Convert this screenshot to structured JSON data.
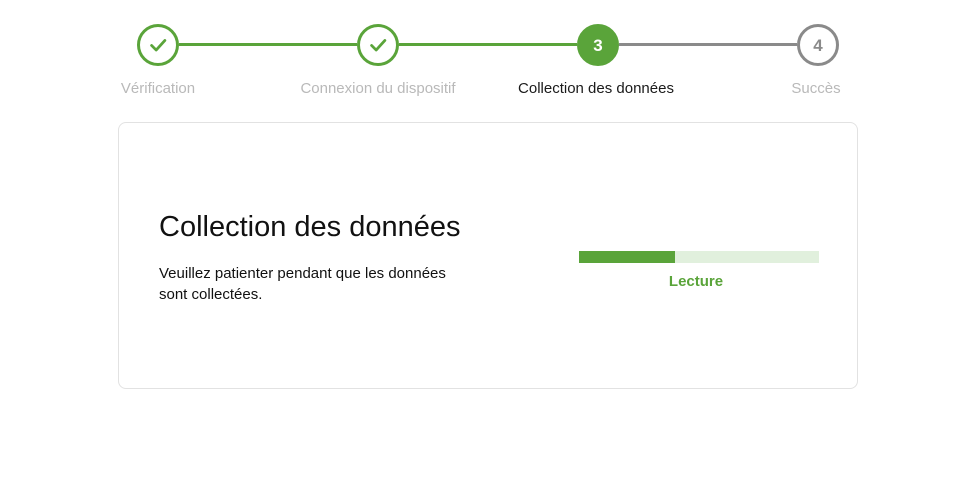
{
  "stepper": {
    "steps": [
      {
        "number": "1",
        "label": "Vérification",
        "state": "completed",
        "icon": "check-icon"
      },
      {
        "number": "2",
        "label": "Connexion du dispositif",
        "state": "completed",
        "icon": "check-icon"
      },
      {
        "number": "3",
        "label": "Collection des données",
        "state": "active"
      },
      {
        "number": "4",
        "label": "Succès",
        "state": "pending"
      }
    ]
  },
  "card": {
    "title": "Collection des données",
    "description": "Veuillez patienter pendant que les données sont collectées.",
    "progress": {
      "label": "Lecture",
      "fraction": 0.4
    }
  },
  "colors": {
    "accent": "#5aa43a",
    "accent_light": "#e1f0dd",
    "pending": "#8a8a8a",
    "muted_text": "#b9b9b9"
  }
}
